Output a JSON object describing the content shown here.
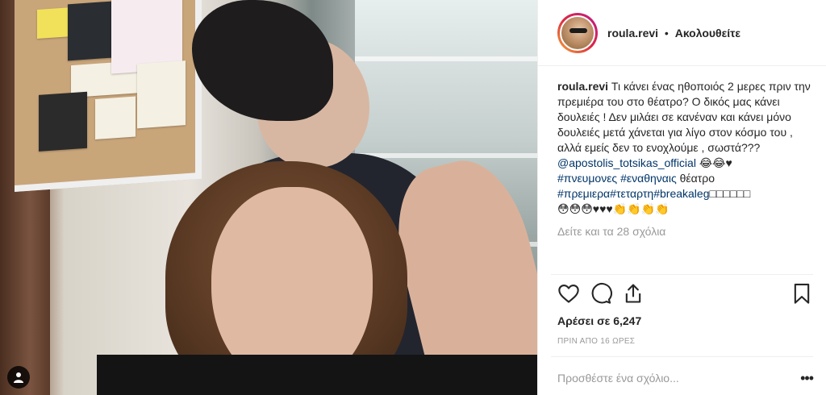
{
  "post": {
    "username": "roula.revi",
    "follow_separator": "•",
    "follow_label": "Ακολουθείτε",
    "caption": {
      "username": "roula.revi",
      "text": "Τι κάνει ένας ηθοποιός 2 μερες πριν την πρεμιέρα του στο θέατρο? Ο δικός μας κάνει δουλειές ! Δεν μιλάει σε κανέναν και κάνει μόνο δουλειές μετά χάνεται για λίγο στον κόσμο του , αλλά εμείς δεν το ενοχλούμε , σωστά???",
      "mention": "@apostolis_totsikas_official",
      "emoji_line1": "😂😂♥",
      "tag1": "#πνευμονες",
      "tag2": "#εναθηναις",
      "word": "θέατρο",
      "tag3": "#πρεμιερα",
      "tag4": "#τεταρτη",
      "tag5": "#breakaleg",
      "boxes": "□□□□□□",
      "emoji_line2": "😳😳😳♥♥♥👏👏👏👏"
    },
    "view_comments": "Δείτε και τα 28 σχόλια",
    "likes": "Αρέσει σε 6,247",
    "timestamp": "ΠΡΙΝ ΑΠΟ 16 ΩΡΕΣ",
    "comment_placeholder": "Προσθέστε ένα σχόλιο...",
    "more_label": "•••"
  },
  "icons": {
    "like": "heart-icon",
    "comment": "comment-icon",
    "share": "share-icon",
    "save": "bookmark-icon",
    "tag": "user-tag-icon"
  },
  "colors": {
    "link": "#003569",
    "muted": "#999999",
    "text": "#262626"
  }
}
